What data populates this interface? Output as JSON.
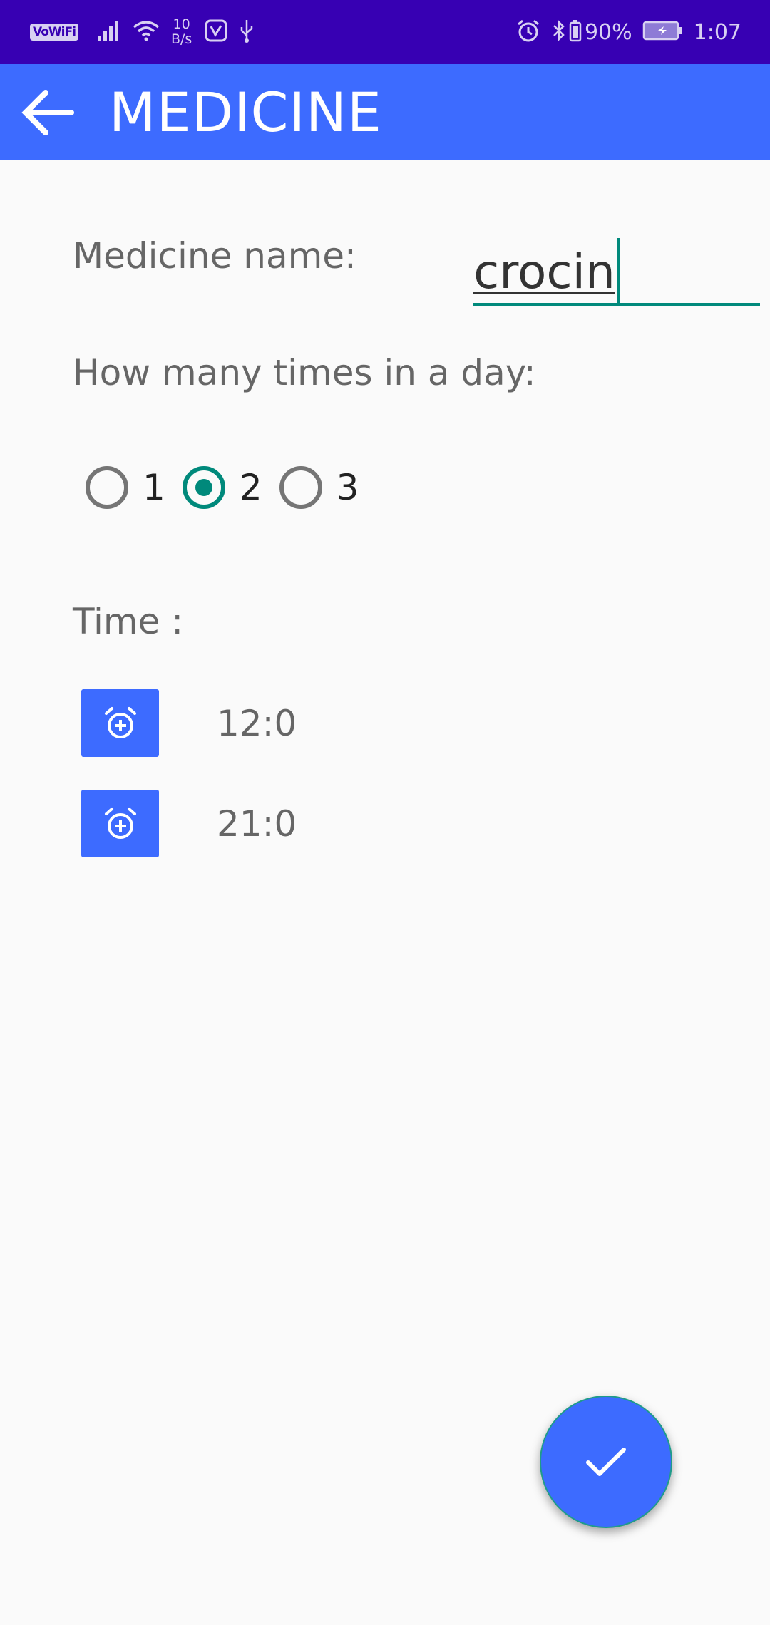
{
  "status_bar": {
    "vowifi": "VoWiFi",
    "speed_value": "10",
    "speed_unit": "B/s",
    "battery": "90%",
    "time": "1:07"
  },
  "app_bar": {
    "title": "MEDICINE"
  },
  "form": {
    "medicine_label": "Medicine name:",
    "medicine_value": "crocin",
    "times_label": "How many times in a day:",
    "options": [
      "1",
      "2",
      "3"
    ],
    "selected_option": "2",
    "time_label": "Time :",
    "times": [
      "12:0",
      "21:0"
    ]
  },
  "colors": {
    "status_bar": "#3700b3",
    "primary": "#3d6bff",
    "accent": "#00897b",
    "background": "#fafafa"
  }
}
